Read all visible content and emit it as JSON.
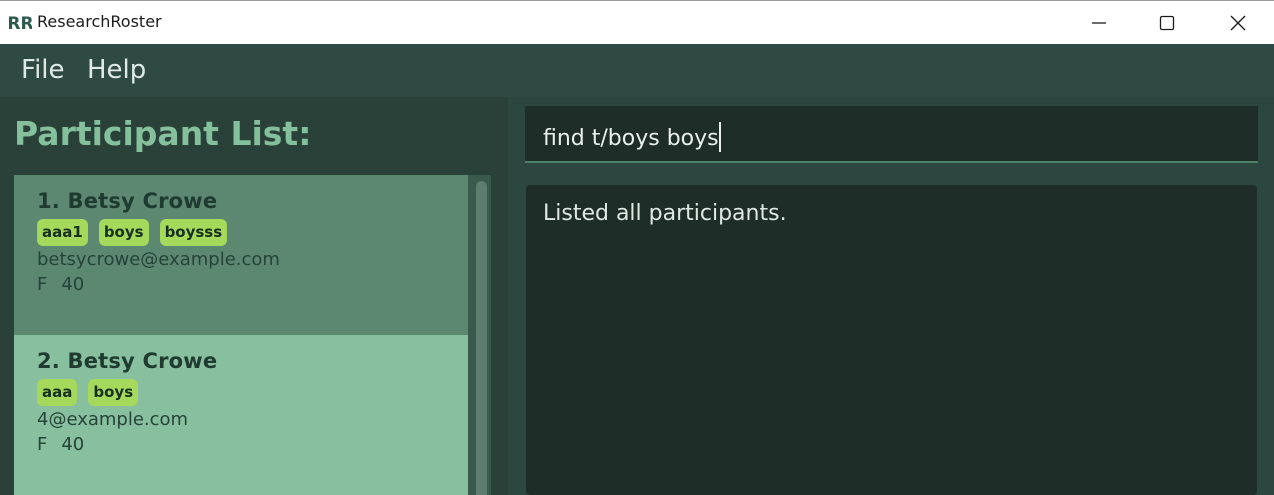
{
  "window": {
    "title": "ResearchRoster",
    "logo_text": "RR",
    "controls": [
      "minimize-icon",
      "maximize-icon",
      "close-icon"
    ]
  },
  "menu": {
    "file": "File",
    "help": "Help"
  },
  "participant_list": {
    "title": "Participant List:",
    "items": [
      {
        "name": "1. Betsy Crowe",
        "tags": [
          "aaa1",
          "boys",
          "boysss"
        ],
        "email": "betsycrowe@example.com",
        "gender": "F",
        "age": "40",
        "selected": true
      },
      {
        "name": "2. Betsy Crowe",
        "tags": [
          "aaa",
          "boys"
        ],
        "email": "4@example.com",
        "gender": "F",
        "age": "40",
        "selected": false
      }
    ]
  },
  "command": {
    "value": "find t/boys boys"
  },
  "result": {
    "message": "Listed all participants."
  },
  "colors": {
    "accent": "#84c09c",
    "tag": "#a4d95c",
    "selected_card": "#5c8872",
    "card": "#88c09f"
  }
}
